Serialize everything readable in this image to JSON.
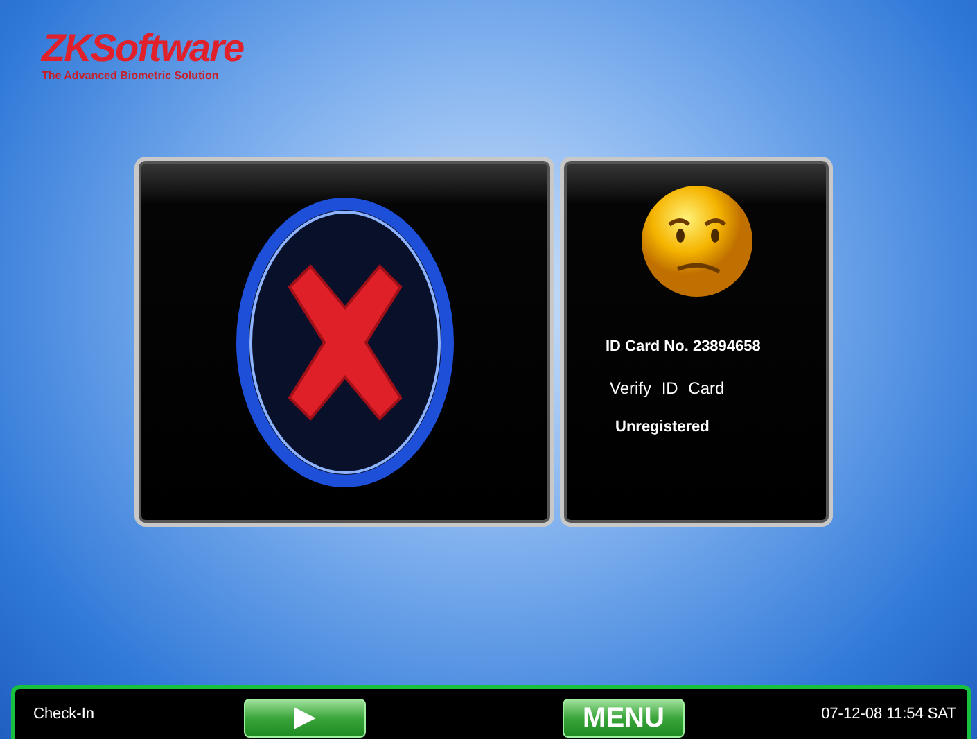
{
  "logo": {
    "name": "ZKSoftware",
    "tagline": "The Advanced Biometric Solution"
  },
  "result": {
    "kind": "failure"
  },
  "info": {
    "card_label": "ID Card No. 23894658",
    "mode": "Verify ID Card",
    "status": "Unregistered"
  },
  "status_bar": {
    "state": "Check-In",
    "buttons": [
      {
        "kind": "play"
      },
      {
        "kind": "text",
        "label": "MENU"
      }
    ],
    "datetime": "07-12-08 11:54 SAT"
  }
}
